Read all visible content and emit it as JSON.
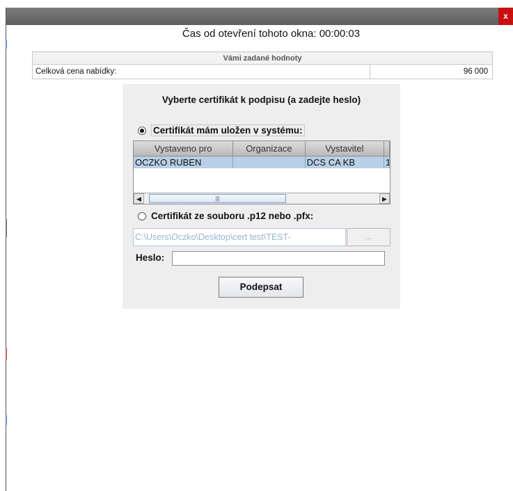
{
  "window": {
    "close_label": "x"
  },
  "timer": {
    "text": "Čas od otevření tohoto okna: 00:00:03"
  },
  "values": {
    "header": "Vámi zadané hodnoty",
    "row_label": "Celková cena nabídky:",
    "row_value": "96 000"
  },
  "panel": {
    "title": "Vyberte certifikát k podpisu (a zadejte heslo)",
    "option_system": {
      "label": "Certifikát mám uložen v systému:",
      "selected": true
    },
    "table": {
      "columns": [
        "Vystaveno pro",
        "Organizace",
        "Vystavitel",
        ""
      ],
      "rows": [
        [
          "OCZKO RUBEN",
          "",
          "DCS CA KB",
          "1"
        ]
      ],
      "scrollbar": {
        "left_arrow": "◀",
        "right_arrow": "▶",
        "thumb_grip": "|||"
      }
    },
    "option_file": {
      "label": "Certifikát ze souboru .p12 nebo .pfx:",
      "selected": false
    },
    "file_path": "C:\\Users\\Oczko\\Desktop\\cert test\\TEST-",
    "browse_label": "...",
    "password_label": "Heslo:",
    "password_value": "",
    "sign_button": "Podepsat"
  }
}
